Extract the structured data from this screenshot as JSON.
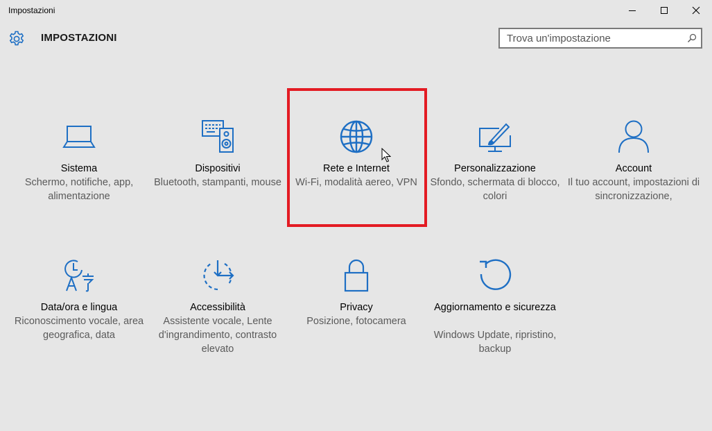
{
  "window": {
    "title": "Impostazioni",
    "controls": [
      "minimize",
      "maximize",
      "close"
    ]
  },
  "header": {
    "title": "IMPOSTAZIONI",
    "icon": "gear-icon"
  },
  "search": {
    "placeholder": "Trova un'impostazione",
    "value": "",
    "icon": "search-icon"
  },
  "accent_color": "#1e6fc4",
  "highlight_color": "#e31b23",
  "categories": [
    {
      "id": "sistema",
      "label": "Sistema",
      "description": "Schermo, notifiche, app, alimentazione",
      "icon": "laptop-icon"
    },
    {
      "id": "dispositivi",
      "label": "Dispositivi",
      "description": "Bluetooth, stampanti, mouse",
      "icon": "devices-icon"
    },
    {
      "id": "rete",
      "label": "Rete e Internet",
      "description": "Wi-Fi, modalità aereo, VPN",
      "icon": "globe-icon",
      "highlighted": true
    },
    {
      "id": "personalizzazione",
      "label": "Personalizzazione",
      "description": "Sfondo, schermata di blocco, colori",
      "icon": "paint-icon"
    },
    {
      "id": "account",
      "label": "Account",
      "description": "Il tuo account, impostazioni di sincronizzazione,",
      "icon": "person-icon"
    },
    {
      "id": "data",
      "label": "Data/ora e lingua",
      "description": "Riconoscimento vocale, area geografica, data",
      "icon": "time-language-icon"
    },
    {
      "id": "accessibilita",
      "label": "Accessibilità",
      "description": "Assistente vocale, Lente d'ingrandimento, contrasto elevato",
      "icon": "ease-of-access-icon"
    },
    {
      "id": "privacy",
      "label": "Privacy",
      "description": "Posizione, fotocamera",
      "icon": "lock-icon"
    },
    {
      "id": "aggiornamento",
      "label": "Aggiornamento e sicurezza",
      "description": "Windows Update, ripristino, backup",
      "icon": "refresh-icon"
    }
  ]
}
